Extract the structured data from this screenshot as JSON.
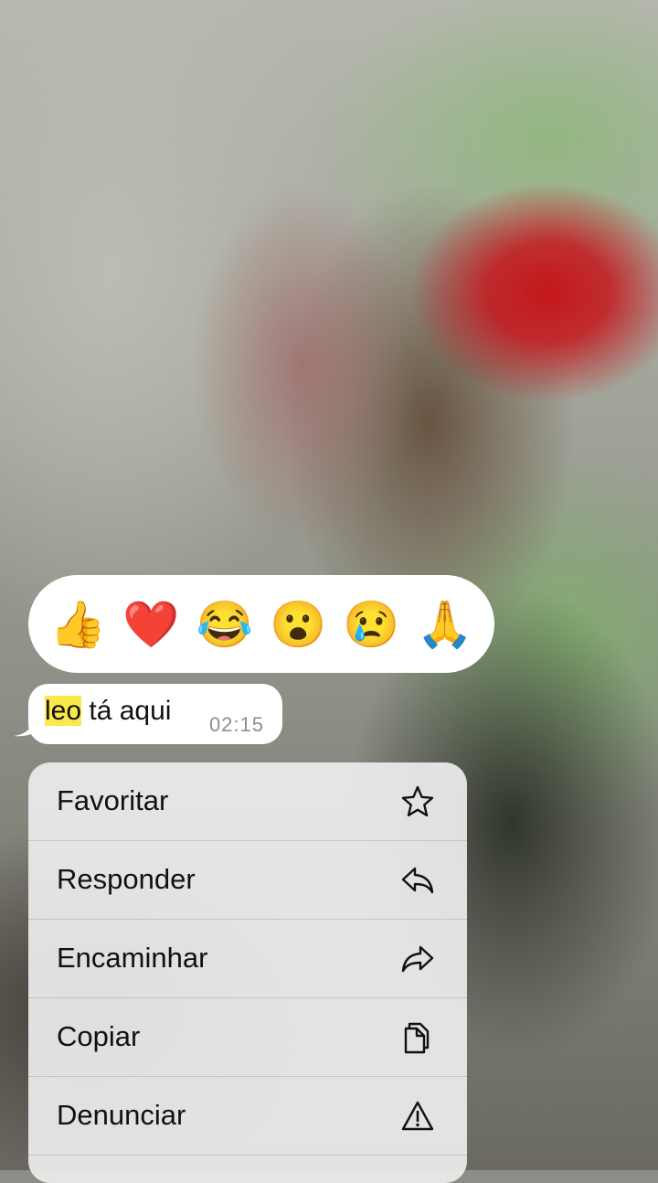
{
  "reactions": {
    "items": [
      {
        "name": "thumbs-up-reaction",
        "glyph": "👍"
      },
      {
        "name": "heart-reaction",
        "glyph": "❤️"
      },
      {
        "name": "laughing-reaction",
        "glyph": "😂"
      },
      {
        "name": "surprised-reaction",
        "glyph": "😮"
      },
      {
        "name": "crying-reaction",
        "glyph": "😢"
      },
      {
        "name": "pray-reaction",
        "glyph": "🙏"
      }
    ]
  },
  "message": {
    "highlight": "leo",
    "rest": " tá aqui",
    "time": "02:15"
  },
  "menu": {
    "items": [
      {
        "label": "Favoritar",
        "icon": "star-icon"
      },
      {
        "label": "Responder",
        "icon": "reply-icon"
      },
      {
        "label": "Encaminhar",
        "icon": "forward-icon"
      },
      {
        "label": "Copiar",
        "icon": "copy-icon"
      },
      {
        "label": "Denunciar",
        "icon": "warning-icon"
      }
    ]
  }
}
